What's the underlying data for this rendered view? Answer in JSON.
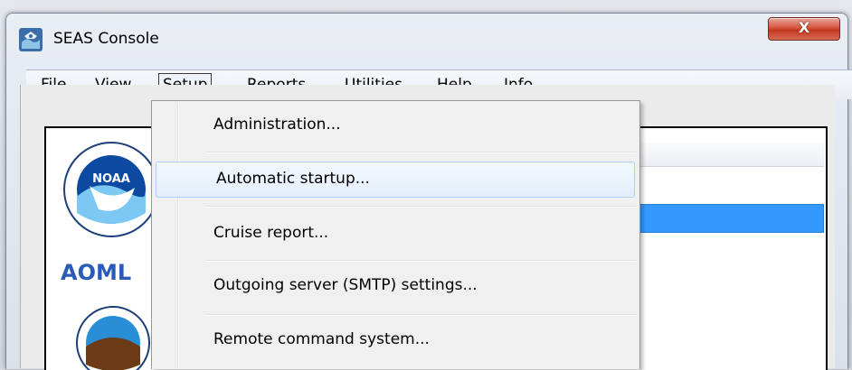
{
  "window": {
    "title": "SEAS Console",
    "close_glyph": "X",
    "icon": "seas-app-icon"
  },
  "menubar": {
    "items": [
      {
        "label": "File"
      },
      {
        "label": "View"
      },
      {
        "label": "Setup",
        "active": true
      },
      {
        "label": "Reports"
      },
      {
        "label": "Utilities"
      },
      {
        "label": "Help"
      },
      {
        "label": "Info"
      }
    ]
  },
  "setup_menu": {
    "items": [
      {
        "label": "Administration..."
      },
      {
        "label": "Automatic startup...",
        "hovered": true
      },
      {
        "label": "Cruise report..."
      },
      {
        "label": "Outgoing server (SMTP) settings..."
      },
      {
        "label": "Remote command system..."
      }
    ]
  },
  "logos": {
    "noaa_text": "NOAA",
    "aoml_text": "AOML"
  },
  "colors": {
    "selection": "#3399ff",
    "menu_hover_border": "#aecff7",
    "close_button": "#c4361e"
  }
}
